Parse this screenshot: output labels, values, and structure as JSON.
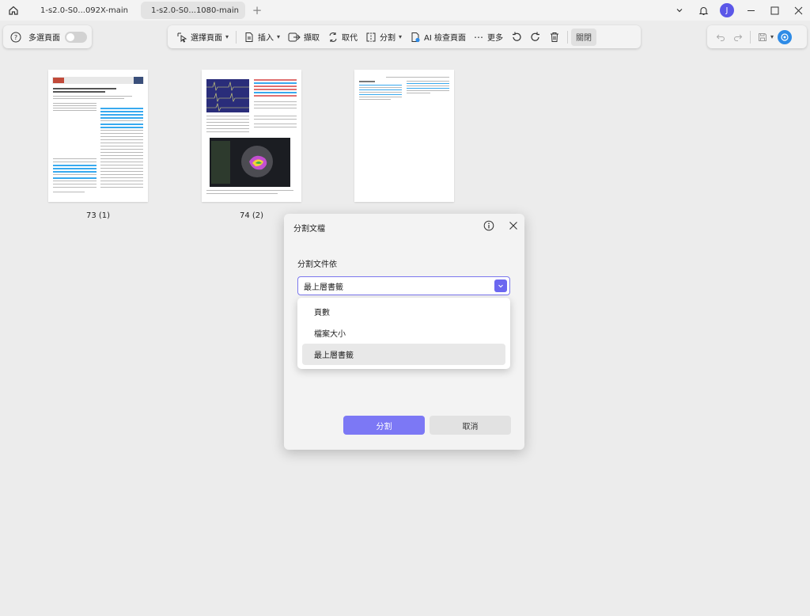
{
  "titlebar": {
    "tabs": [
      {
        "label": "1-s2.0-S0...092X-main"
      },
      {
        "label": "1-s2.0-S0...1080-main"
      }
    ],
    "new_tab": "+",
    "avatar_initial": "J"
  },
  "left_panel": {
    "multi_select_label": "多選頁面"
  },
  "toolbar": {
    "select_pages": "選擇頁面",
    "insert": "插入",
    "extract": "擷取",
    "replace": "取代",
    "split": "分割",
    "ai_check": "AI 檢查頁面",
    "more": "更多",
    "close": "關閉"
  },
  "pages": [
    {
      "label": "73 (1)"
    },
    {
      "label": "74 (2)"
    },
    {
      "label": ""
    }
  ],
  "dialog": {
    "title": "分割文檔",
    "split_by_label": "分割文件依",
    "selected_value": "最上層書籤",
    "options": [
      {
        "label": "頁數"
      },
      {
        "label": "檔案大小"
      },
      {
        "label": "最上層書籤",
        "selected": true
      }
    ],
    "split_button": "分割",
    "cancel_button": "取消"
  },
  "colors": {
    "accent": "#7c78f5",
    "select_border": "#7b77ee",
    "avatar": "#5b57e8"
  }
}
